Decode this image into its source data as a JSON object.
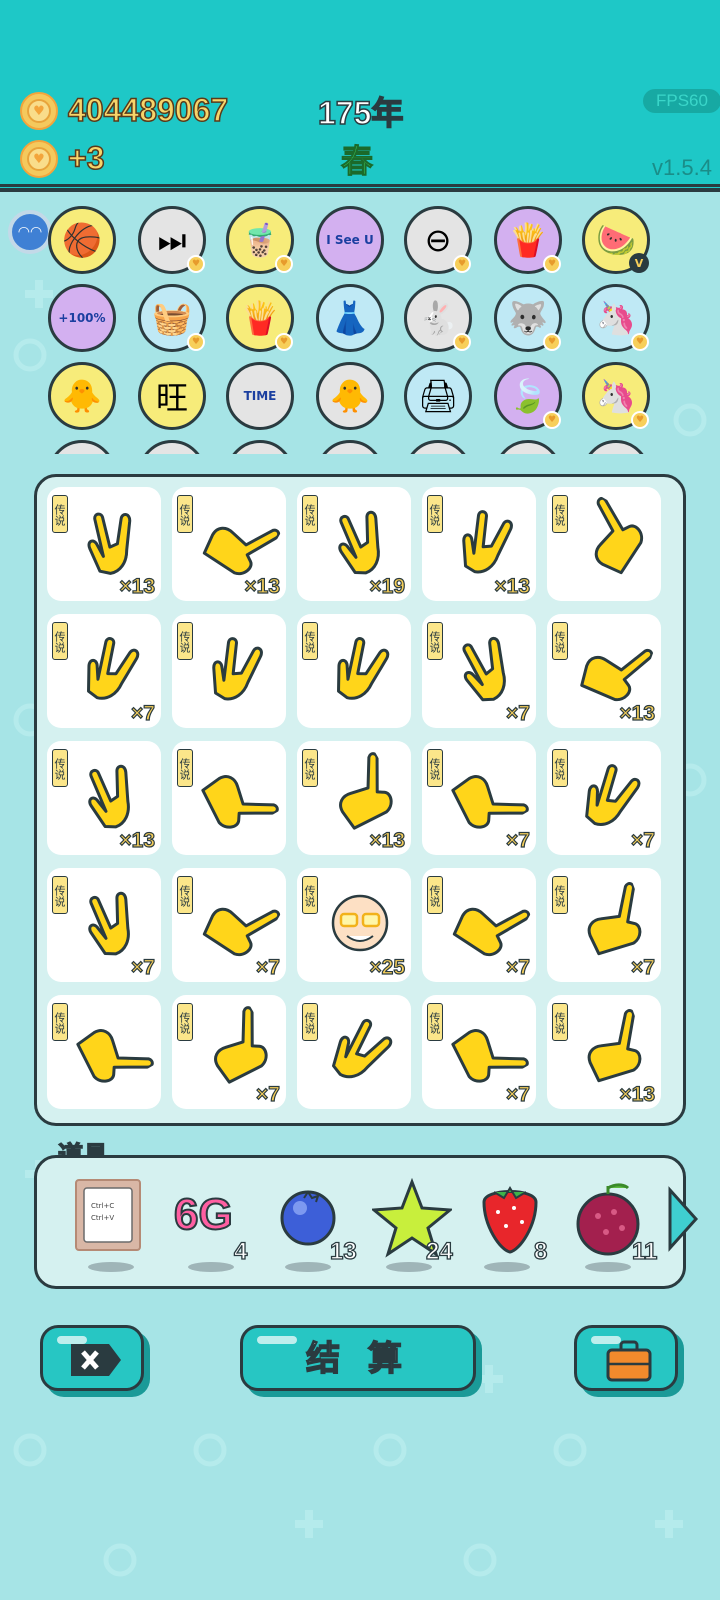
{
  "header": {
    "coins": "404489067",
    "income": "+3",
    "year": "175年",
    "season": "春",
    "fps": "FPS60",
    "version": "v1.5.4"
  },
  "tray": {
    "icons": [
      {
        "name": "basketballs-icon",
        "glyph": "🏀",
        "bg": "#f7ec7a",
        "badge": "none"
      },
      {
        "name": "skip-icon",
        "glyph": "⏭",
        "bg": "#e4e4e4",
        "badge": "heart"
      },
      {
        "name": "bubble-tea-icon",
        "glyph": "🧋",
        "bg": "#f7ec7a",
        "badge": "heart"
      },
      {
        "name": "i-see-u-icon",
        "glyph": "I See U",
        "bg": "#d3b0f0",
        "badge": "none"
      },
      {
        "name": "no-entry-icon",
        "glyph": "⊖",
        "bg": "#e4e4e4",
        "badge": "heart"
      },
      {
        "name": "fries-icon",
        "glyph": "🍟",
        "bg": "#d3b0f0",
        "badge": "heart"
      },
      {
        "name": "fruit-basket-icon",
        "glyph": "🍉",
        "bg": "#f7ec7a",
        "badge": "v"
      },
      {
        "name": "boost-cup-icon",
        "glyph": "+100%",
        "bg": "#d3b0f0",
        "badge": "none"
      },
      {
        "name": "basket-icon",
        "glyph": "🧺",
        "bg": "#bfe9f5",
        "badge": "heart"
      },
      {
        "name": "fries-icon",
        "glyph": "🍟",
        "bg": "#f7ec7a",
        "badge": "heart"
      },
      {
        "name": "skirt-icon",
        "glyph": "👗",
        "bg": "#bfe9f5",
        "badge": "none"
      },
      {
        "name": "rabbit-icon",
        "glyph": "🐇",
        "bg": "#e4e4e4",
        "badge": "heart"
      },
      {
        "name": "husky-icon",
        "glyph": "🐺",
        "bg": "#bfe9f5",
        "badge": "heart"
      },
      {
        "name": "unicorns-icon",
        "glyph": "🦄",
        "bg": "#bfe9f5",
        "badge": "heart"
      },
      {
        "name": "chick-egg-icon",
        "glyph": "🐥",
        "bg": "#f7ec7a",
        "badge": "none"
      },
      {
        "name": "wang-text-icon",
        "glyph": "旺",
        "bg": "#f7ec7a",
        "badge": "none"
      },
      {
        "name": "time-magazine-icon",
        "glyph": "TIME",
        "bg": "#e4e4e4",
        "badge": "none"
      },
      {
        "name": "chick-egg-icon",
        "glyph": "🐥",
        "bg": "#e4e4e4",
        "badge": "none"
      },
      {
        "name": "printer-icon",
        "glyph": "🖨",
        "bg": "#bfe9f5",
        "badge": "none"
      },
      {
        "name": "leaf-icon",
        "glyph": "🍃",
        "bg": "#d3b0f0",
        "badge": "heart"
      },
      {
        "name": "unicorn-icon",
        "glyph": "🦄",
        "bg": "#f7ec7a",
        "badge": "heart"
      }
    ]
  },
  "board": {
    "tag": "传说",
    "tiles": [
      {
        "icon": "rock-hand-icon",
        "rot": -10,
        "count": "×13"
      },
      {
        "icon": "point-hand-icon",
        "rot": 30,
        "count": "×13"
      },
      {
        "icon": "rock-hand-icon",
        "rot": -20,
        "count": "×19"
      },
      {
        "icon": "rock-hand-icon",
        "rot": 10,
        "count": "×13"
      },
      {
        "icon": "point-hand-icon",
        "rot": -60,
        "count": ""
      },
      {
        "icon": "rock-hand-icon",
        "rot": 15,
        "count": "×7"
      },
      {
        "icon": "rock-hand-icon",
        "rot": 10,
        "count": ""
      },
      {
        "icon": "rock-hand-icon",
        "rot": 15,
        "count": ""
      },
      {
        "icon": "rock-hand-icon",
        "rot": -25,
        "count": "×7"
      },
      {
        "icon": "point-hand-icon",
        "rot": 20,
        "count": "×13"
      },
      {
        "icon": "rock-hand-icon",
        "rot": -20,
        "count": "×13"
      },
      {
        "icon": "point-hand-icon",
        "rot": 60,
        "count": ""
      },
      {
        "icon": "point-hand-icon",
        "rot": -30,
        "count": "×13"
      },
      {
        "icon": "point-hand-icon",
        "rot": 60,
        "count": "×7"
      },
      {
        "icon": "rock-hand-icon",
        "rot": 20,
        "count": "×7"
      },
      {
        "icon": "rock-hand-icon",
        "rot": -20,
        "count": "×7"
      },
      {
        "icon": "point-hand-icon",
        "rot": 30,
        "count": "×7"
      },
      {
        "icon": "bald-man-face-icon",
        "rot": 0,
        "count": "×25"
      },
      {
        "icon": "point-hand-icon",
        "rot": 30,
        "count": "×7"
      },
      {
        "icon": "point-hand-icon",
        "rot": -20,
        "count": "×7"
      },
      {
        "icon": "point-hand-icon",
        "rot": 60,
        "count": ""
      },
      {
        "icon": "point-hand-icon",
        "rot": -30,
        "count": "×7"
      },
      {
        "icon": "rock-hand-icon",
        "rot": 30,
        "count": ""
      },
      {
        "icon": "point-hand-icon",
        "rot": 60,
        "count": "×7"
      },
      {
        "icon": "point-hand-icon",
        "rot": -20,
        "count": "×13"
      }
    ]
  },
  "tools": {
    "label": "道具",
    "items": [
      {
        "name": "ctrl-c-ctrl-v-tool-icon",
        "text1": "Ctrl+C",
        "text2": "Ctrl+V",
        "count": ""
      },
      {
        "name": "6g-tool-icon",
        "text1": "6G",
        "count": "4"
      },
      {
        "name": "blueberry-tool-icon",
        "count": "13"
      },
      {
        "name": "star-tool-icon",
        "count": "24"
      },
      {
        "name": "strawberry-tool-icon",
        "count": "8"
      },
      {
        "name": "bayberry-tool-icon",
        "count": "11"
      }
    ]
  },
  "buttons": {
    "settle": "结 算"
  },
  "colors": {
    "header": "#1ec8c7",
    "background": "#a6e4e6",
    "coin_text": "#f7d56a",
    "season_green": "#40d060",
    "button_teal": "#27c6c3"
  }
}
